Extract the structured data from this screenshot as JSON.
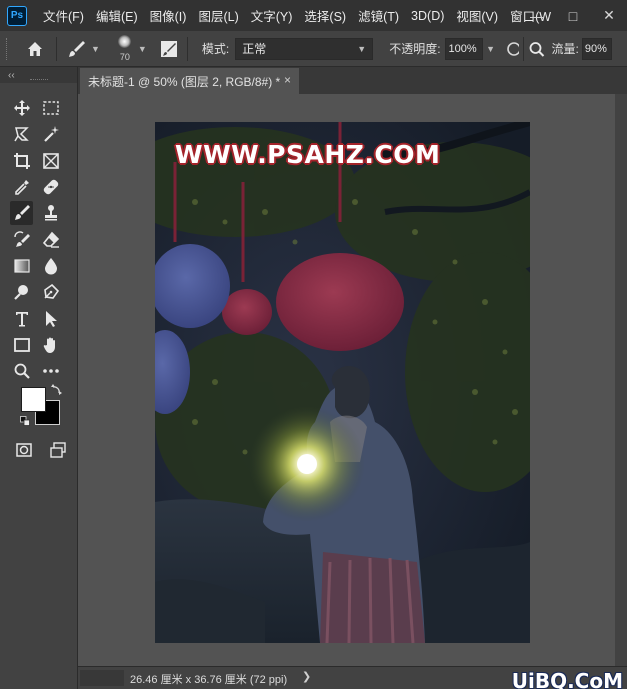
{
  "app": {
    "logo_text": "Ps",
    "menu": [
      "文件(F)",
      "编辑(E)",
      "图像(I)",
      "图层(L)",
      "文字(Y)",
      "选择(S)",
      "滤镜(T)",
      "3D(D)",
      "视图(V)",
      "窗口(W"
    ],
    "window_buttons": {
      "minimize": "—",
      "restore": "□",
      "close": "✕"
    }
  },
  "options": {
    "brush_size": "70",
    "mode_label": "模式:",
    "mode_value": "正常",
    "opacity_label": "不透明度:",
    "opacity_value": "100%",
    "flow_label": "流量:",
    "flow_value": "90%"
  },
  "toolbar": {
    "collapse_label": "‹‹",
    "foreground_color": "#ffffff",
    "background_color": "#000000"
  },
  "document": {
    "tab_title": "未标题-1 @ 50% (图层 2, RGB/8#) *",
    "tab_close": "×",
    "watermark": "WWW.PSAHZ.COM"
  },
  "status": {
    "dimensions": "26.46 厘米 x 36.76 厘米 (72 ppi)",
    "arrow": "❯",
    "site_badge": "UiBQ.CoM"
  }
}
